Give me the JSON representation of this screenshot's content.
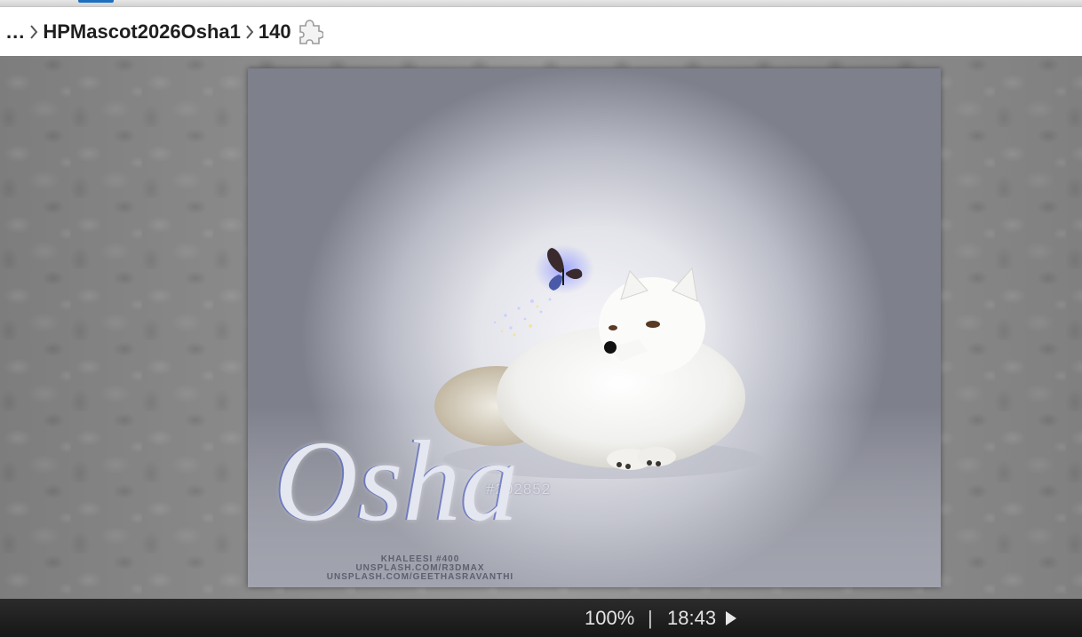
{
  "breadcrumb": {
    "ellipsis": "...",
    "folder": "HPMascot2026Osha1",
    "item": "140",
    "extension_icon": "puzzle-piece-icon"
  },
  "image": {
    "alt": "Arctic fox lying in snow with a butterfly",
    "hashtag": "#202852",
    "name": "Osha",
    "credit_lines": [
      "Khaleesi #400",
      "unsplash.com/r3dmax",
      "unsplash.com/geethasravanthi"
    ]
  },
  "status_bar": {
    "zoom": "100%",
    "divider": "|",
    "time": "18:43",
    "play_icon": "play-icon"
  },
  "colors": {
    "status_bar_bg": "#1f1f1f",
    "breadcrumb_text": "#1f1f1f",
    "viewer_bg": "#8a8a8a"
  }
}
